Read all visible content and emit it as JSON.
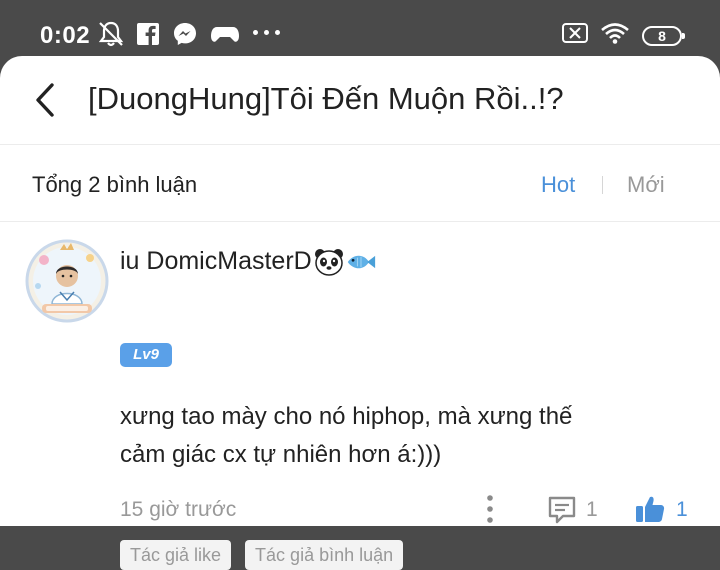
{
  "status_bar": {
    "time": "0:02",
    "battery": "8",
    "icons_left": [
      "mute-bell-icon",
      "facebook-icon",
      "messenger-icon",
      "gamepad-icon",
      "more-dots-icon"
    ],
    "icons_right": [
      "sim-off-icon",
      "wifi-icon",
      "battery-icon"
    ]
  },
  "header": {
    "title": "[DuongHung]Tôi Đến Muộn Rồi..!?",
    "back_icon": "chevron-left-icon"
  },
  "comments_bar": {
    "count_text": "Tổng 2 bình luận",
    "sort_hot": "Hot",
    "sort_new": "Mới",
    "active_sort": "Hot",
    "accent_color": "#4a90d9"
  },
  "comment": {
    "username": "iu DomicMasterD",
    "username_emojis": [
      "panda-icon",
      "fish-icon"
    ],
    "level": "Lv9",
    "text_line1": "xưng tao mày cho nó hiphop, mà xưng thế",
    "text_line2": "cảm giác cx tự nhiên hơn á:)))",
    "time": "15 giờ trước",
    "reply_count": "1",
    "like_count": "1",
    "tags": [
      "Tác giả like",
      "Tác giả bình luận"
    ]
  }
}
